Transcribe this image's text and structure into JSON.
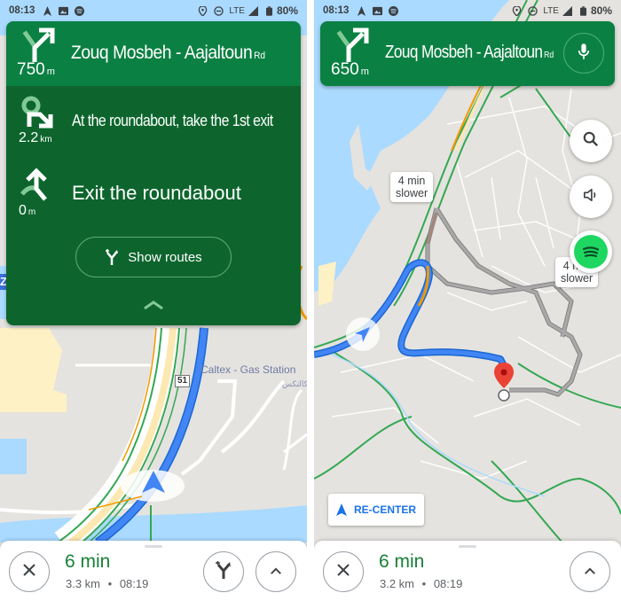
{
  "screens": [
    {
      "status_bar": {
        "time": "08:13",
        "network": "LTE",
        "battery": "80%",
        "icons": [
          "navigation-icon",
          "image-icon",
          "spotify-icon",
          "location-icon",
          "dnd-icon",
          "signal-icon",
          "battery-icon"
        ]
      },
      "map_labels": {
        "poi": "Caltex - Gas Station",
        "poi_ar": "كالتكس",
        "road_shield": "51",
        "edge_label": "Z"
      },
      "header": {
        "distance": "750",
        "distance_unit": "m",
        "street": "Zouq Mosbeh - Aajaltoun",
        "street_suffix": "Rd",
        "maneuver": "slight-right-icon"
      },
      "steps": [
        {
          "distance": "2.2",
          "unit": "km",
          "instruction": "At the roundabout, take the 1st exit",
          "maneuver": "roundabout-icon"
        },
        {
          "distance": "0",
          "unit": "m",
          "instruction": "Exit the roundabout",
          "maneuver": "roundabout-exit-icon"
        }
      ],
      "show_routes_label": "Show routes",
      "bottom": {
        "eta": "6 min",
        "distance": "3.3 km",
        "separator": "•",
        "arrival": "08:19"
      }
    },
    {
      "status_bar": {
        "time": "08:13",
        "network": "LTE",
        "battery": "80%"
      },
      "header": {
        "distance": "650",
        "distance_unit": "m",
        "street": "Zouq Mosbeh - Aajaltoun",
        "street_suffix": "Rd",
        "maneuver": "slight-right-icon"
      },
      "bubbles": [
        {
          "line1": "4 min",
          "line2": "slower"
        },
        {
          "line1": "4 min",
          "line2": "slower"
        }
      ],
      "recenter_label": "RE-CENTER",
      "bottom": {
        "eta": "6 min",
        "distance": "3.2 km",
        "separator": "•",
        "arrival": "08:19"
      }
    }
  ],
  "colors": {
    "nav_green": "#0b8043",
    "nav_dark_green": "#0d652d",
    "route_blue": "#4285f4",
    "eta_green": "#188038",
    "water": "#aadaff",
    "map_bg": "#e5e3df",
    "alt_route_gray": "#9e9e9e",
    "pin_red": "#ea4335",
    "spotify": "#1ed760"
  }
}
